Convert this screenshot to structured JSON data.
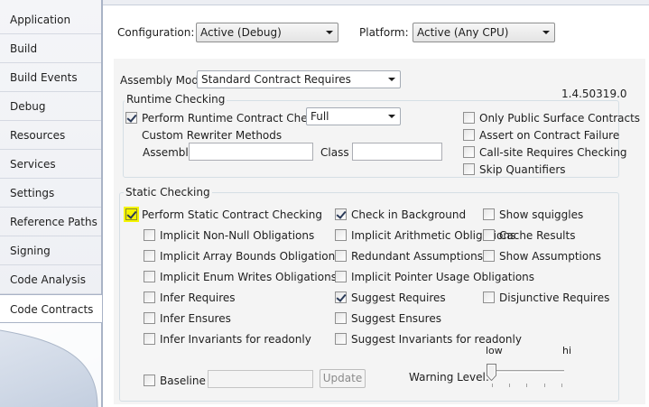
{
  "nav": {
    "items": [
      {
        "label": "Application"
      },
      {
        "label": "Build"
      },
      {
        "label": "Build Events"
      },
      {
        "label": "Debug"
      },
      {
        "label": "Resources"
      },
      {
        "label": "Services"
      },
      {
        "label": "Settings"
      },
      {
        "label": "Reference Paths"
      },
      {
        "label": "Signing"
      },
      {
        "label": "Code Analysis"
      },
      {
        "label": "Code Contracts"
      }
    ],
    "selected": "Code Contracts"
  },
  "header": {
    "configuration_label": "Configuration:",
    "configuration_value": "Active (Debug)",
    "platform_label": "Platform:",
    "platform_value": "Active (Any CPU)"
  },
  "assembly": {
    "mode_label": "Assembly Mode:",
    "mode_value": "Standard Contract Requires",
    "version": "1.4.50319.0"
  },
  "runtime": {
    "title": "Runtime Checking",
    "perform_label": "Perform Runtime Contract Checking",
    "perform_checked": true,
    "level_value": "Full",
    "rewriter_label": "Custom Rewriter Methods",
    "assembly_label": "Assembly",
    "assembly_value": "",
    "class_label": "Class",
    "class_value": "",
    "options": [
      {
        "label": "Only Public Surface Contracts",
        "checked": false
      },
      {
        "label": "Assert on Contract Failure",
        "checked": false
      },
      {
        "label": "Call-site Requires Checking",
        "checked": false
      },
      {
        "label": "Skip Quantifiers",
        "checked": false
      }
    ]
  },
  "static": {
    "title": "Static Checking",
    "perform_label": "Perform Static Contract Checking",
    "perform_checked": true,
    "col1": [
      {
        "label": "Implicit Non-Null Obligations",
        "checked": false
      },
      {
        "label": "Implicit Array Bounds Obligations",
        "checked": false
      },
      {
        "label": "Implicit Enum Writes Obligations",
        "checked": false
      },
      {
        "label": "Infer Requires",
        "checked": false
      },
      {
        "label": "Infer Ensures",
        "checked": false
      },
      {
        "label": "Infer Invariants for readonly",
        "checked": false
      }
    ],
    "col2": [
      {
        "label": "Check in Background",
        "checked": true
      },
      {
        "label": "Implicit Arithmetic Obligations",
        "checked": false
      },
      {
        "label": "Redundant Assumptions",
        "checked": false
      },
      {
        "label": "Implicit Pointer Usage Obligations",
        "checked": false
      },
      {
        "label": "Suggest Requires",
        "checked": true
      },
      {
        "label": "Suggest Ensures",
        "checked": false
      },
      {
        "label": "Suggest Invariants for readonly",
        "checked": false
      }
    ],
    "col3": [
      {
        "label": "Show squiggles",
        "checked": false
      },
      {
        "label": "Cache Results",
        "checked": false
      },
      {
        "label": "Show Assumptions",
        "checked": false
      },
      {
        "label": "Disjunctive Requires",
        "checked": false
      }
    ],
    "baseline_label": "Baseline",
    "baseline_checked": false,
    "baseline_value": "",
    "update_label": "Update",
    "warning_level_label": "Warning Level:",
    "slider_low": "low",
    "slider_hi": "hi",
    "warning_level_value": 0
  },
  "colors": {
    "highlight": "#f5f500",
    "nav_selected_bg": "#ffffff",
    "nav_bg": "#f0f2f6"
  }
}
